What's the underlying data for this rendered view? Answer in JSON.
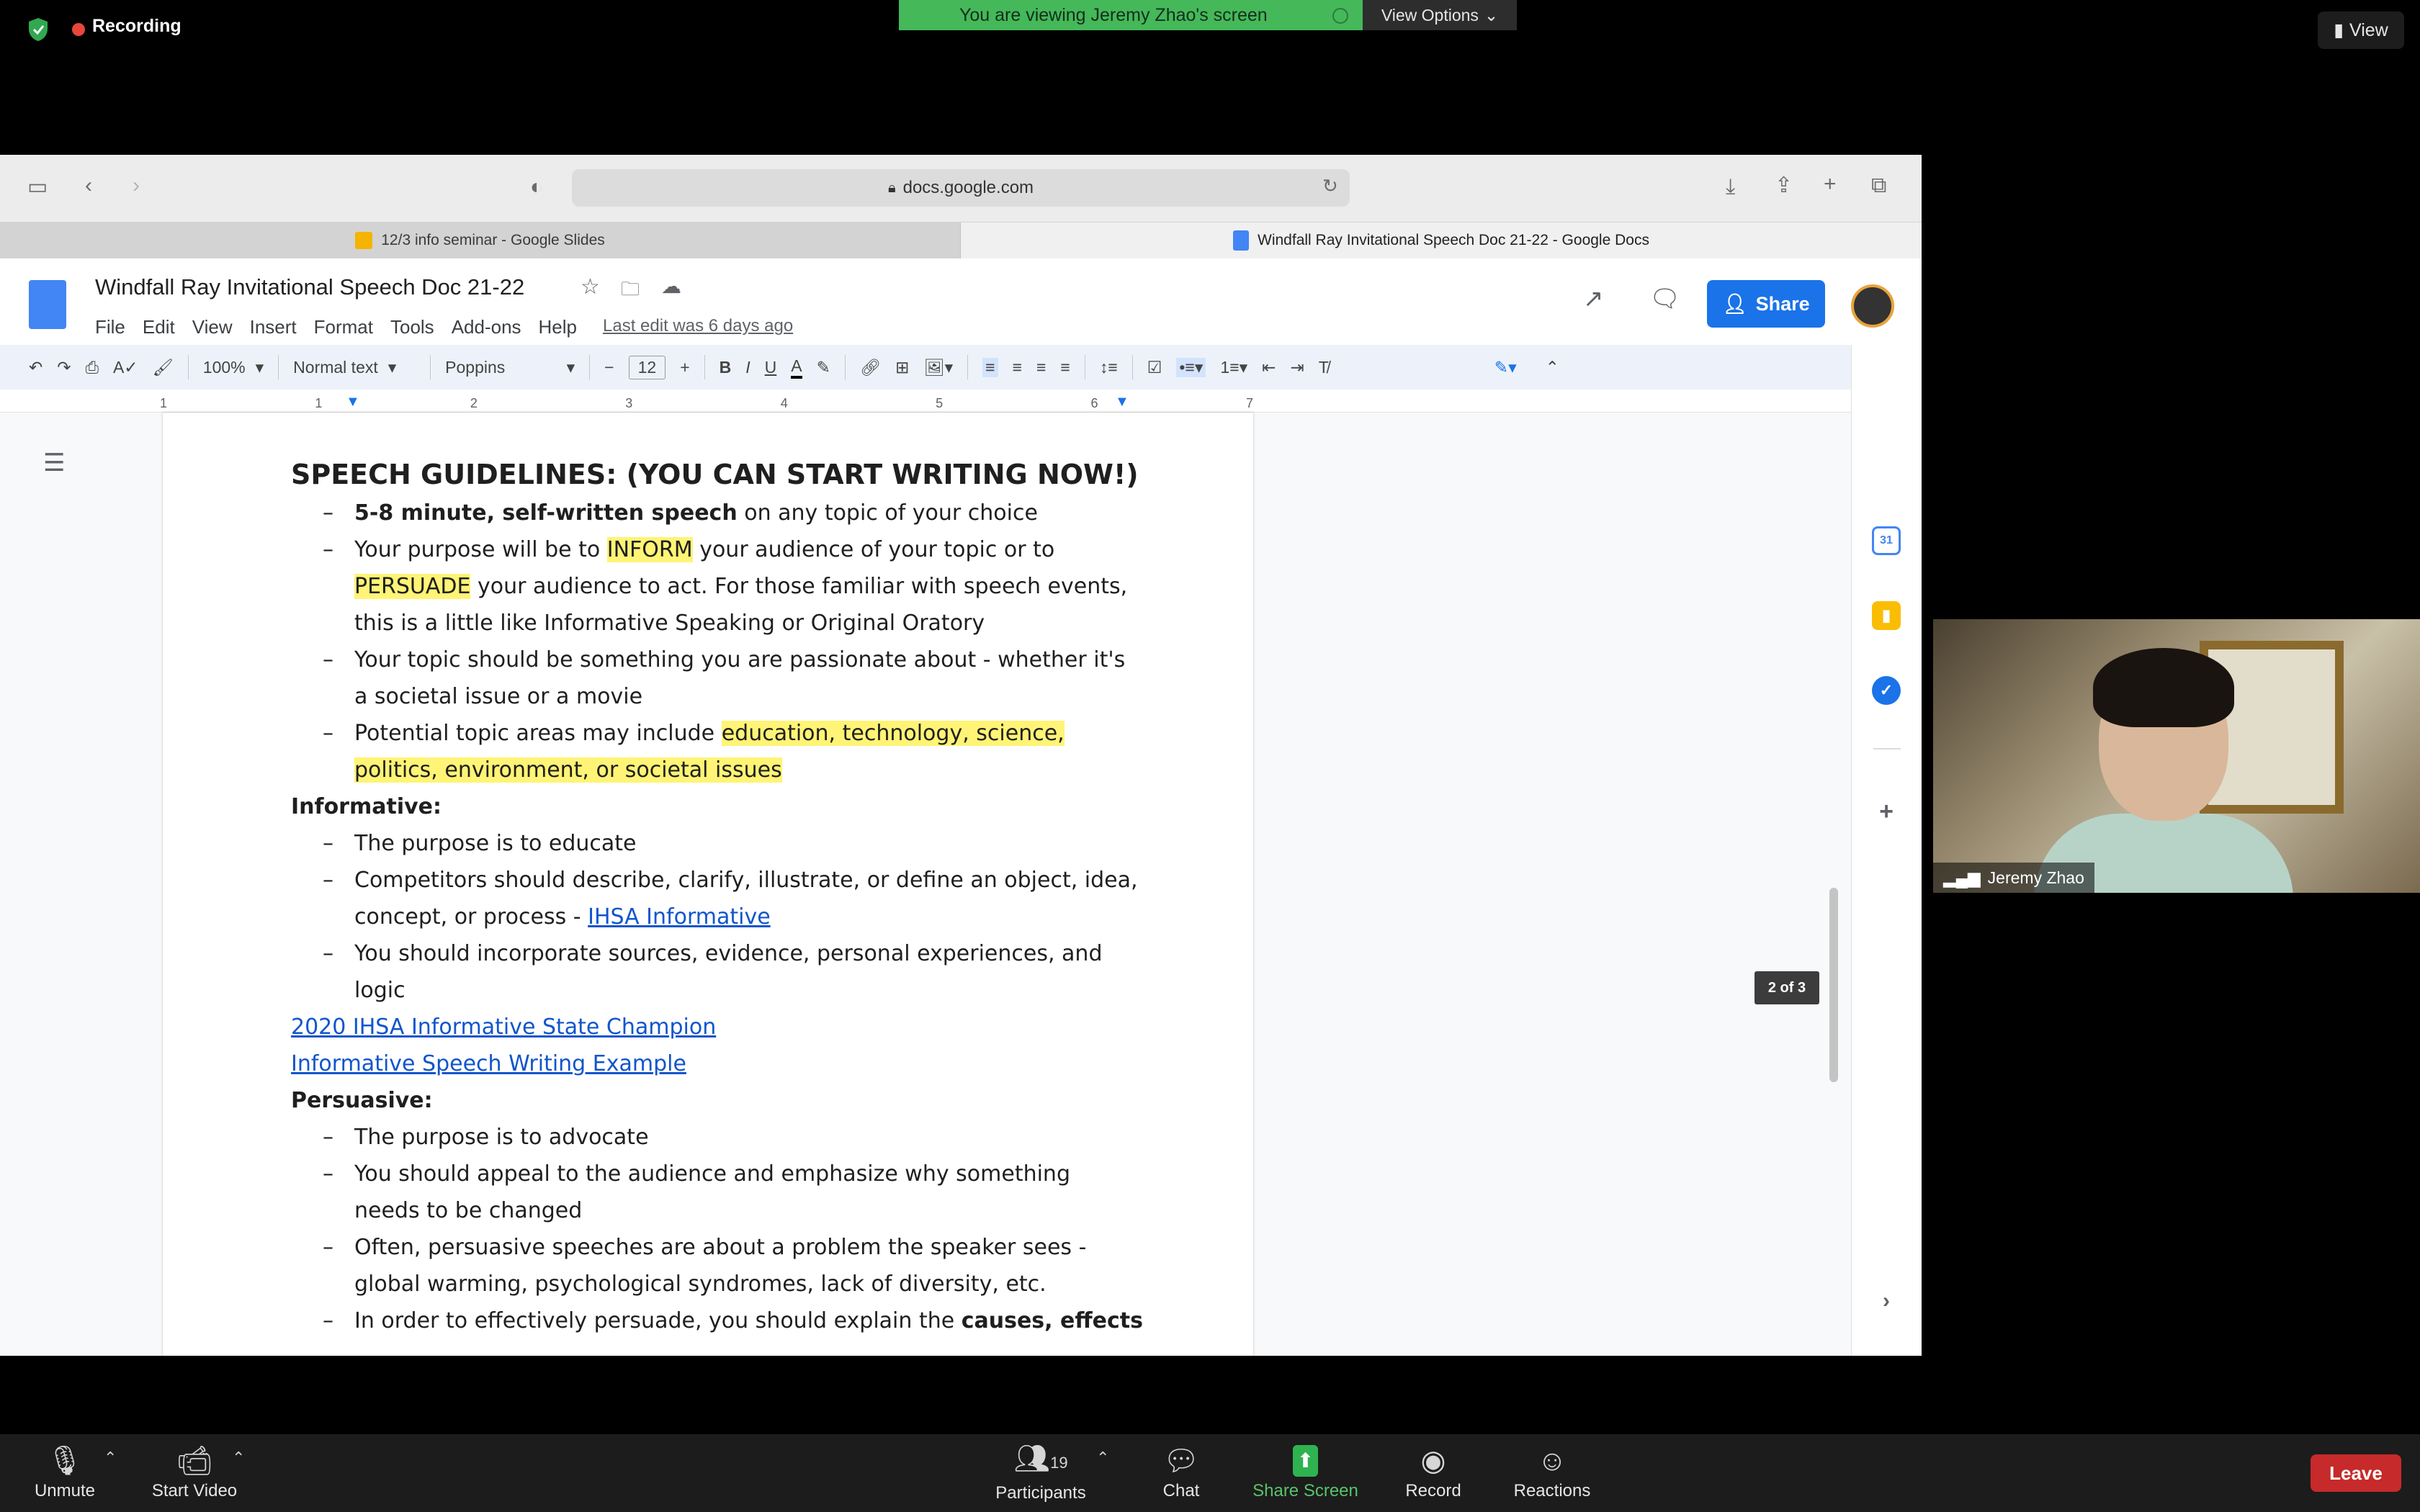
{
  "zoom": {
    "recording_label": "Recording",
    "viewing_banner": "You are viewing Jeremy Zhao's screen",
    "view_options": "View Options",
    "view_button": "View",
    "participant_name": "Jeremy Zhao",
    "bottom": {
      "unmute": "Unmute",
      "start_video": "Start Video",
      "participants": "Participants",
      "participants_count": "19",
      "chat": "Chat",
      "share_screen": "Share Screen",
      "record": "Record",
      "reactions": "Reactions",
      "leave": "Leave"
    }
  },
  "browser": {
    "url": "docs.google.com",
    "tabs": [
      {
        "label": "12/3 info seminar - Google Slides"
      },
      {
        "label": "Windfall Ray Invitational Speech Doc 21-22 - Google Docs"
      }
    ]
  },
  "docs": {
    "title": "Windfall Ray Invitational Speech Doc 21-22",
    "menu": [
      "File",
      "Edit",
      "View",
      "Insert",
      "Format",
      "Tools",
      "Add-ons",
      "Help"
    ],
    "last_edit": "Last edit was 6 days ago",
    "share": "Share",
    "toolbar": {
      "zoom": "100%",
      "style": "Normal text",
      "font": "Poppins",
      "size": "12"
    },
    "ruler": [
      "1",
      "1",
      "2",
      "3",
      "4",
      "5",
      "6",
      "7"
    ],
    "page_badge": "2 of 3",
    "content": {
      "heading": "SPEECH GUIDELINES: (YOU CAN START WRITING NOW!)",
      "g1_bold": "5-8 minute, self-written speech",
      "g1_rest": " on any topic of your choice",
      "g2_a": "Your purpose will be to ",
      "g2_inform": "INFORM",
      "g2_b": " your audience of your topic or to",
      "g2_persuade": "PERSUADE",
      "g2_c": " your audience to act. For those familiar with speech events,",
      "g2_d": "this is a little like Informative Speaking or Original Oratory",
      "g3_a": "Your topic should be something you are passionate about - whether it's",
      "g3_b": "a societal issue or a movie",
      "g4_a": "Potential topic areas may include ",
      "g4_hl1": "education, technology, science,",
      "g4_hl2": "politics, environment, or societal issues",
      "informative": "Informative:",
      "i1": "The purpose is to educate",
      "i2_a": "Competitors should describe, clarify, illustrate, or define an object, idea,",
      "i2_b": "concept, or process - ",
      "i2_link": "IHSA Informative",
      "i3_a": "You should incorporate sources, evidence, personal experiences, and",
      "i3_b": "logic",
      "link1": "2020 IHSA Informative State Champion",
      "link2": "Informative Speech Writing Example",
      "persuasive": "Persuasive:",
      "p1": "The purpose is to advocate",
      "p2_a": "You should appeal to the audience and emphasize why something",
      "p2_b": "needs to be changed",
      "p3_a": "Often, persuasive speeches are about a problem the speaker sees -",
      "p3_b": "global warming, psychological syndromes, lack of diversity, etc.",
      "p4_a": "In order to effectively persuade, you should explain the ",
      "p4_b": "causes, effects"
    }
  },
  "colors": {
    "zoom_green": "#45b85a",
    "docs_blue": "#1a73e8",
    "highlight": "#fff475",
    "link": "#1155cc",
    "leave_red": "#c62a2a"
  }
}
